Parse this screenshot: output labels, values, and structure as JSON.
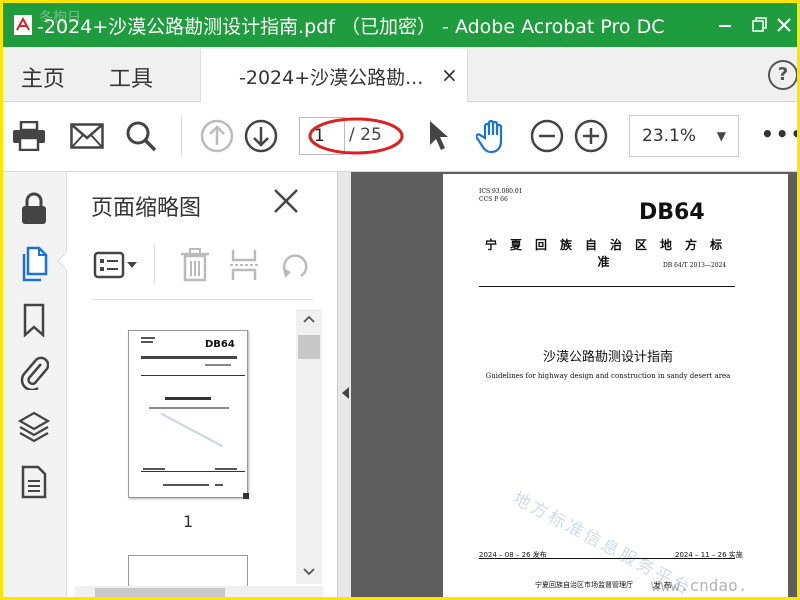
{
  "window": {
    "title": "-2024+沙漠公路勘测设计指南.pdf （已加密） - Adobe Acrobat Pro DC",
    "watermark": "冬枸日",
    "accent": "#1f9d3e"
  },
  "tabs": {
    "home": "主页",
    "tools": "工具",
    "document": "-2024+沙漠公路勘...",
    "close": "×",
    "help": "?"
  },
  "toolbar": {
    "current_page": "1",
    "page_total": "/ 25",
    "zoom": "23.1%",
    "zoom_caret": "▼",
    "more": "•••"
  },
  "thumbnails": {
    "title": "页面缩略图",
    "page_label": "1"
  },
  "page": {
    "ics": "ICS  93.080.01",
    "ccs": "CCS  P 66",
    "logo": "DB64",
    "standard_name": "宁夏回族自治区地方标准",
    "standard_no": "DB 64/T 2013—2024",
    "title_cn": "沙漠公路勘测设计指南",
    "title_en": "Guidelines for highway design and construction in sandy desert area",
    "publish_date": "2024 – 08 – 26 发布",
    "implement_date": "2024 – 11 – 26 实施",
    "issuer": "宁夏回族自治区市场监督管理厅",
    "issued": "发 布",
    "watermark": "地方标准信息服务平台",
    "site_watermark": "www.cndao."
  }
}
